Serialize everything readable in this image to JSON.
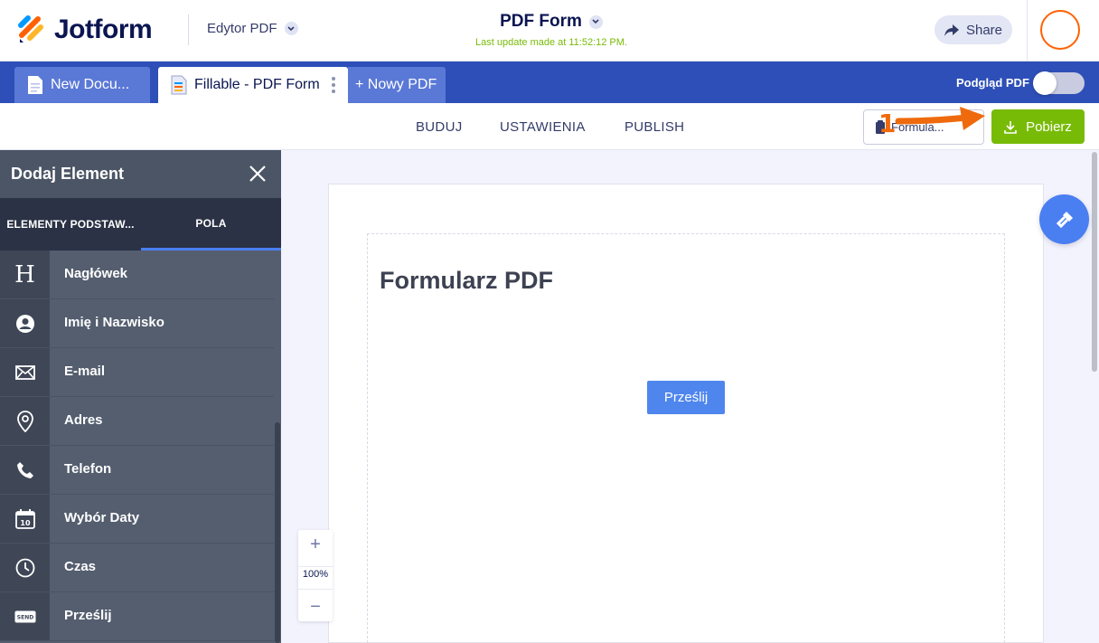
{
  "app": {
    "brand": "Jotform",
    "editor_select": "Edytor PDF",
    "doc_title": "PDF Form",
    "last_update": "Last update made at 11:52:12 PM.",
    "share": "Share"
  },
  "tabs": {
    "items": [
      {
        "label": "New Docu..."
      },
      {
        "label": "Fillable - PDF Form"
      }
    ],
    "add": "+ Nowy PDF",
    "preview_label": "Podgląd PDF",
    "preview_on": false
  },
  "subnav": {
    "build": "BUDUJ",
    "settings": "USTAWIENIA",
    "publish": "PUBLISH",
    "form_button": "Formula...",
    "download": "Pobierz"
  },
  "panel": {
    "title": "Dodaj Element",
    "tab_basic": "ELEMENTY PODSTAW...",
    "tab_fields": "POLA",
    "items": [
      {
        "label": "Nagłówek",
        "icon": "heading-icon"
      },
      {
        "label": "Imię i Nazwisko",
        "icon": "user-icon"
      },
      {
        "label": "E-mail",
        "icon": "envelope-icon"
      },
      {
        "label": "Adres",
        "icon": "location-pin-icon"
      },
      {
        "label": "Telefon",
        "icon": "phone-icon"
      },
      {
        "label": "Wybór Daty",
        "icon": "calendar-icon"
      },
      {
        "label": "Czas",
        "icon": "clock-icon"
      },
      {
        "label": "Prześlij",
        "icon": "send-icon"
      }
    ]
  },
  "canvas": {
    "heading": "Formularz PDF",
    "submit": "Prześlij",
    "zoom": "100%"
  },
  "annotation": {
    "step": "1",
    "color": "#ef6a0c"
  },
  "colors": {
    "brand_navy": "#0a1551",
    "tab_bar": "#2d4fb7",
    "download_green": "#78bb07",
    "submit_blue": "#4f86ee",
    "avatar_orange": "#ff6100"
  }
}
